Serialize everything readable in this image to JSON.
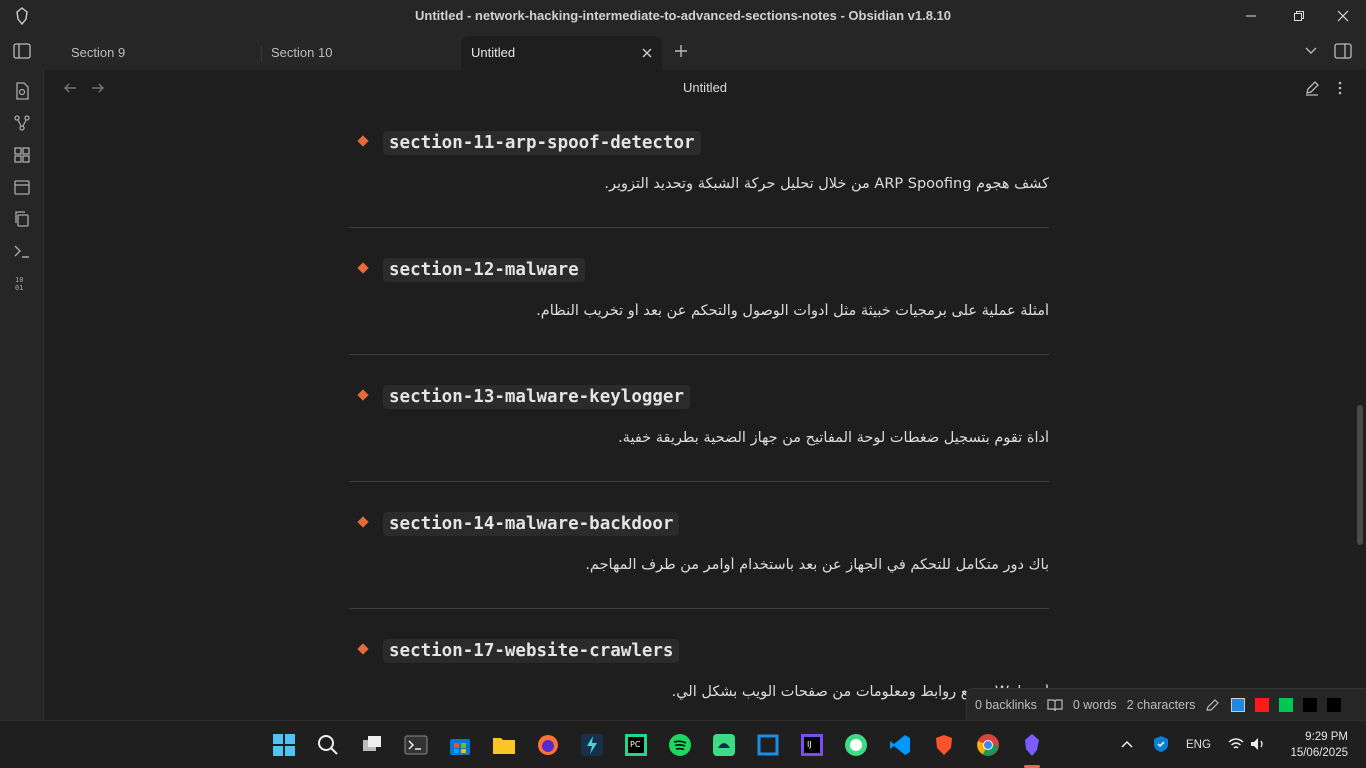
{
  "window": {
    "title": "Untitled - network-hacking-intermediate-to-advanced-sections-notes - Obsidian v1.8.10"
  },
  "tabs": [
    {
      "label": "Section 9"
    },
    {
      "label": "Section 10"
    },
    {
      "label": "Untitled"
    }
  ],
  "view": {
    "title": "Untitled"
  },
  "notes": [
    {
      "title": "section-11-arp-spoof-detector",
      "desc": "كشف هجوم ARP Spoofing من خلال تحليل حركة الشبكة وتحديد التزوير."
    },
    {
      "title": "section-12-malware",
      "desc": "أمثلة عملية على برمجيات خبيثة مثل أدوات الوصول والتحكم عن بعد أو تخريب النظام."
    },
    {
      "title": "section-13-malware-keylogger",
      "desc": "أداة تقوم بتسجيل ضغطات لوحة المفاتيح من جهاز الضحية بطريقة خفية."
    },
    {
      "title": "section-14-malware-backdoor",
      "desc": "باك دور متكامل للتحكم في الجهاز عن بعد باستخدام أوامر من طرف المهاجم."
    },
    {
      "title": "section-17-website-crawlers",
      "desc": "أ... Web تجمع روابط ومعلومات من صفحات الويب بشكل آلي."
    }
  ],
  "status": {
    "backlinks": "0 backlinks",
    "words": "0 words",
    "characters": "2 characters",
    "swatches": [
      "#1e88e5",
      "#ff0000",
      "#00c853",
      "#000000",
      "#000000"
    ]
  },
  "taskbar": {
    "lang": "ENG",
    "time": "9:29 PM",
    "date": "15/06/2025"
  },
  "colors": {
    "accent": "#e86a3a",
    "background": "#1e1e1e",
    "chrome": "#262626"
  }
}
